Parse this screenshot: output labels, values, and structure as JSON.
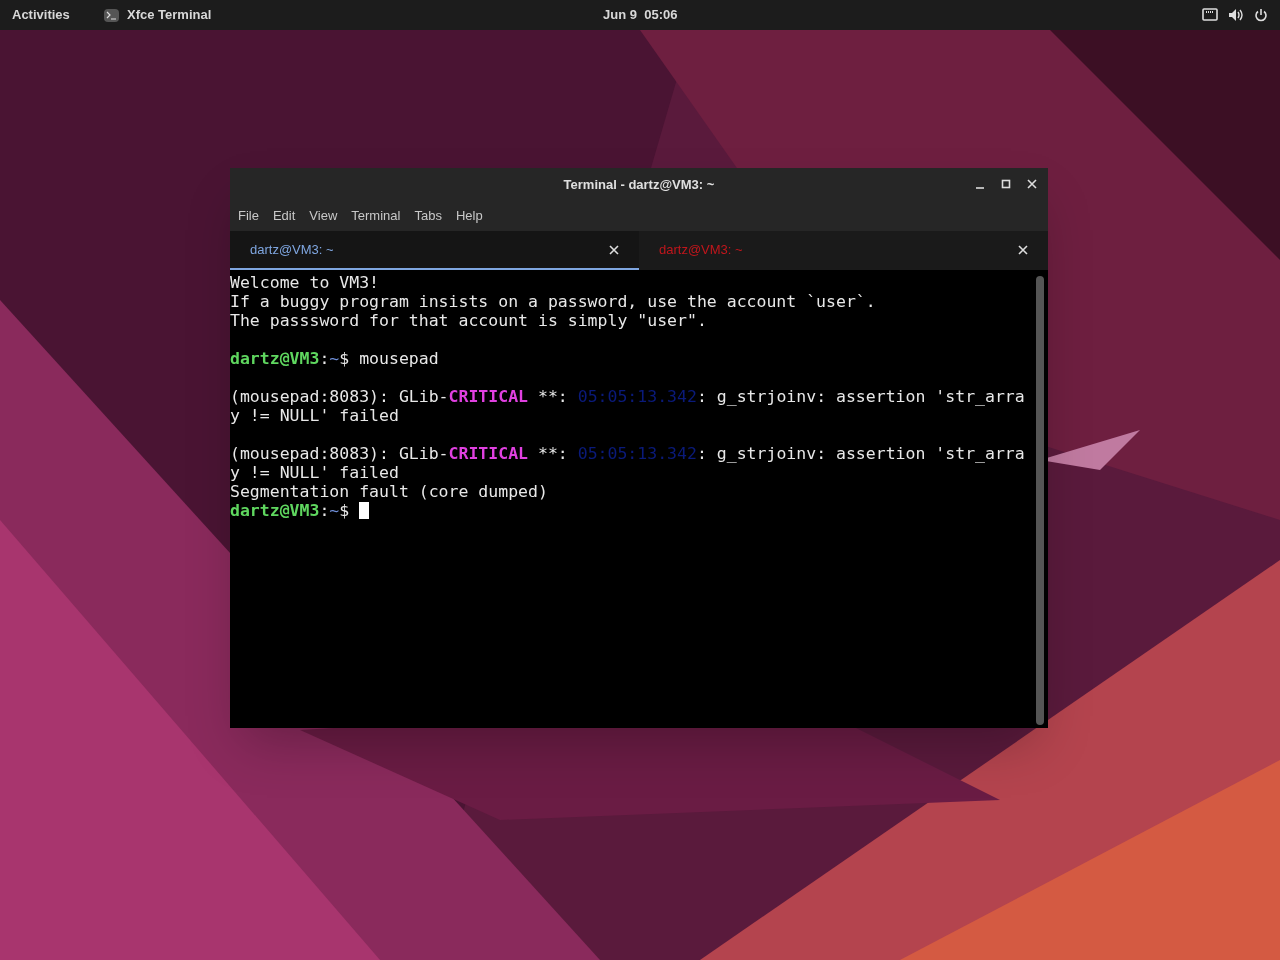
{
  "top_bar": {
    "activities": "Activities",
    "app_name": "Xfce Terminal",
    "clock": "Jun 9  05:06"
  },
  "window": {
    "title": "Terminal - dartz@VM3: ~"
  },
  "menu": [
    "File",
    "Edit",
    "View",
    "Terminal",
    "Tabs",
    "Help"
  ],
  "tabs": [
    {
      "label": "dartz@VM3: ~",
      "selected": true,
      "color": "#7fa6e0"
    },
    {
      "label": "dartz@VM3: ~",
      "selected": false,
      "color": "#c0161c"
    }
  ],
  "terminal": {
    "cursor": true,
    "paragraphs": [
      [
        [
          {
            "kind": "plain",
            "text": "Welcome to VM3!"
          }
        ],
        [
          {
            "kind": "plain",
            "text": "If a buggy program insists on a password, use the account `user`."
          }
        ],
        [
          {
            "kind": "plain",
            "text": "The passsword for that account is simply \"user\"."
          }
        ]
      ],
      [
        [
          {
            "kind": "user",
            "text": "dartz@VM3"
          },
          {
            "kind": "plain",
            "text": ":"
          },
          {
            "kind": "path",
            "text": "~"
          },
          {
            "kind": "plain",
            "text": "$ mousepad"
          }
        ]
      ],
      [
        [
          {
            "kind": "plain",
            "text": "(mousepad:8083): GLib-"
          },
          {
            "kind": "critical",
            "text": "CRITICAL"
          },
          {
            "kind": "plain",
            "text": " **: "
          },
          {
            "kind": "timestamp",
            "text": "05:05:13.342"
          },
          {
            "kind": "plain",
            "text": ": g_strjoinv: assertion 'str_arra"
          }
        ],
        [
          {
            "kind": "plain",
            "text": "y != NULL' failed"
          }
        ]
      ],
      [
        [
          {
            "kind": "plain",
            "text": "(mousepad:8083): GLib-"
          },
          {
            "kind": "critical",
            "text": "CRITICAL"
          },
          {
            "kind": "plain",
            "text": " **: "
          },
          {
            "kind": "timestamp",
            "text": "05:05:13.342"
          },
          {
            "kind": "plain",
            "text": ": g_strjoinv: assertion 'str_arra"
          }
        ],
        [
          {
            "kind": "plain",
            "text": "y != NULL' failed"
          }
        ],
        [
          {
            "kind": "plain",
            "text": "Segmentation fault (core dumped)"
          }
        ],
        [
          {
            "kind": "user",
            "text": "dartz@VM3"
          },
          {
            "kind": "plain",
            "text": ":"
          },
          {
            "kind": "path",
            "text": "~"
          },
          {
            "kind": "plain",
            "text": "$ "
          }
        ]
      ]
    ]
  }
}
